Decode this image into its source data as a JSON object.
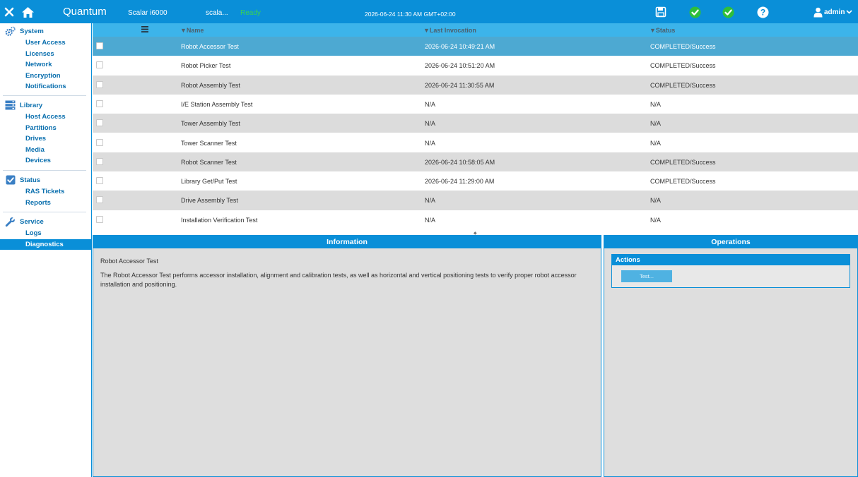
{
  "header": {
    "brand": "Quantum",
    "model": "Scalar i6000",
    "library_name": "scala...",
    "state": "Ready",
    "datetime": "2026-06-24 11:30 AM GMT+02:00",
    "user": "admin",
    "colors": {
      "bar": "#0a8fd8",
      "ready": "#39d353",
      "ok": "#2fbf3a"
    }
  },
  "sidebar": {
    "sections": [
      {
        "title": "System",
        "icon": "gears-icon",
        "items": [
          "User Access",
          "Licenses",
          "Network",
          "Encryption",
          "Notifications"
        ]
      },
      {
        "title": "Library",
        "icon": "library-icon",
        "items": [
          "Host Access",
          "Partitions",
          "Drives",
          "Media",
          "Devices"
        ]
      },
      {
        "title": "Status",
        "icon": "checkbox-icon",
        "items": [
          "RAS Tickets",
          "Reports"
        ]
      },
      {
        "title": "Service",
        "icon": "wrench-icon",
        "items": [
          "Logs",
          "Diagnostics"
        ]
      }
    ],
    "active_item": "Diagnostics"
  },
  "table": {
    "columns": [
      "Name",
      "Last Invocation",
      "Status"
    ],
    "rows": [
      {
        "name": "Robot Accessor Test",
        "last": "2026-06-24 10:49:21 AM",
        "status": "COMPLETED/Success"
      },
      {
        "name": "Robot Picker Test",
        "last": "2026-06-24 10:51:20 AM",
        "status": "COMPLETED/Success"
      },
      {
        "name": "Robot Assembly Test",
        "last": "2026-06-24 11:30:55 AM",
        "status": "COMPLETED/Success"
      },
      {
        "name": "I/E Station Assembly Test",
        "last": "N/A",
        "status": "N/A"
      },
      {
        "name": "Tower Assembly Test",
        "last": "N/A",
        "status": "N/A"
      },
      {
        "name": "Tower Scanner Test",
        "last": "N/A",
        "status": "N/A"
      },
      {
        "name": "Robot Scanner Test",
        "last": "2026-06-24 10:58:05 AM",
        "status": "COMPLETED/Success"
      },
      {
        "name": "Library Get/Put Test",
        "last": "2026-06-24 11:29:00 AM",
        "status": "COMPLETED/Success"
      },
      {
        "name": "Drive Assembly Test",
        "last": "N/A",
        "status": "N/A"
      },
      {
        "name": "Installation Verification Test",
        "last": "N/A",
        "status": "N/A"
      }
    ]
  },
  "information": {
    "title": "Information",
    "test_name": "Robot Accessor Test",
    "description": "The Robot Accessor Test performs accessor installation, alignment and calibration tests, as well as horizontal and vertical positioning tests to verify proper robot accessor installation and positioning."
  },
  "operations": {
    "title": "Operations",
    "actions_title": "Actions",
    "test_button": "Test..."
  }
}
